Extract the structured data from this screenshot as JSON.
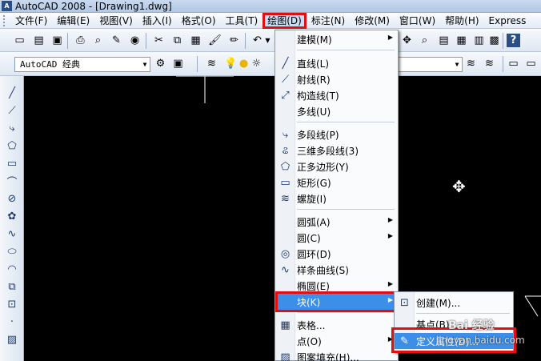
{
  "window": {
    "title": "AutoCAD 2008 - [Drawing1.dwg]",
    "logo": "A"
  },
  "menubar": {
    "items": [
      "文件(F)",
      "编辑(E)",
      "视图(V)",
      "插入(I)",
      "格式(O)",
      "工具(T)",
      "绘图(D)",
      "标注(N)",
      "修改(M)",
      "窗口(W)",
      "帮助(H)",
      "Express"
    ],
    "active": "绘图(D)"
  },
  "workspace_combo": {
    "value": "AutoCAD 经典"
  },
  "draw_menu": {
    "items": [
      {
        "label": "建模(M)",
        "icon": "",
        "submenu": true
      },
      {
        "label": "直线(L)",
        "icon": "line-icon",
        "submenu": false
      },
      {
        "label": "射线(R)",
        "icon": "ray-icon",
        "submenu": false
      },
      {
        "label": "构造线(T)",
        "icon": "construction-line-icon",
        "submenu": false
      },
      {
        "label": "多线(U)",
        "icon": "",
        "submenu": false
      },
      {
        "label": "多段线(P)",
        "icon": "polyline-icon",
        "submenu": false
      },
      {
        "label": "三维多段线(3)",
        "icon": "3d-polyline-icon",
        "submenu": false
      },
      {
        "label": "正多边形(Y)",
        "icon": "polygon-icon",
        "submenu": false
      },
      {
        "label": "矩形(G)",
        "icon": "rectangle-icon",
        "submenu": false
      },
      {
        "label": "螺旋(I)",
        "icon": "helix-icon",
        "submenu": false
      },
      {
        "label": "圆弧(A)",
        "icon": "",
        "submenu": true
      },
      {
        "label": "圆(C)",
        "icon": "",
        "submenu": true
      },
      {
        "label": "圆环(D)",
        "icon": "donut-icon",
        "submenu": false
      },
      {
        "label": "样条曲线(S)",
        "icon": "spline-icon",
        "submenu": false
      },
      {
        "label": "椭圆(E)",
        "icon": "",
        "submenu": true
      },
      {
        "label": "块(K)",
        "icon": "",
        "submenu": true,
        "highlighted": true
      },
      {
        "label": "表格...",
        "icon": "table-icon",
        "submenu": false
      },
      {
        "label": "点(O)",
        "icon": "",
        "submenu": true
      },
      {
        "label": "图案填充(H)...",
        "icon": "hatch-icon",
        "submenu": false
      }
    ]
  },
  "block_submenu": {
    "items": [
      {
        "label": "创建(M)...",
        "icon": "create-block-icon"
      },
      {
        "label": "基点(B)",
        "icon": ""
      },
      {
        "label": "定义属性(D)...",
        "icon": "define-attribute-icon",
        "highlighted": true
      }
    ]
  },
  "watermark": {
    "text": "Bai 经验",
    "url": "jingyan.baidu.com"
  },
  "colors": {
    "highlight": "#3d8ee8",
    "annotation_red": "#e01010",
    "canvas": "#000000"
  }
}
